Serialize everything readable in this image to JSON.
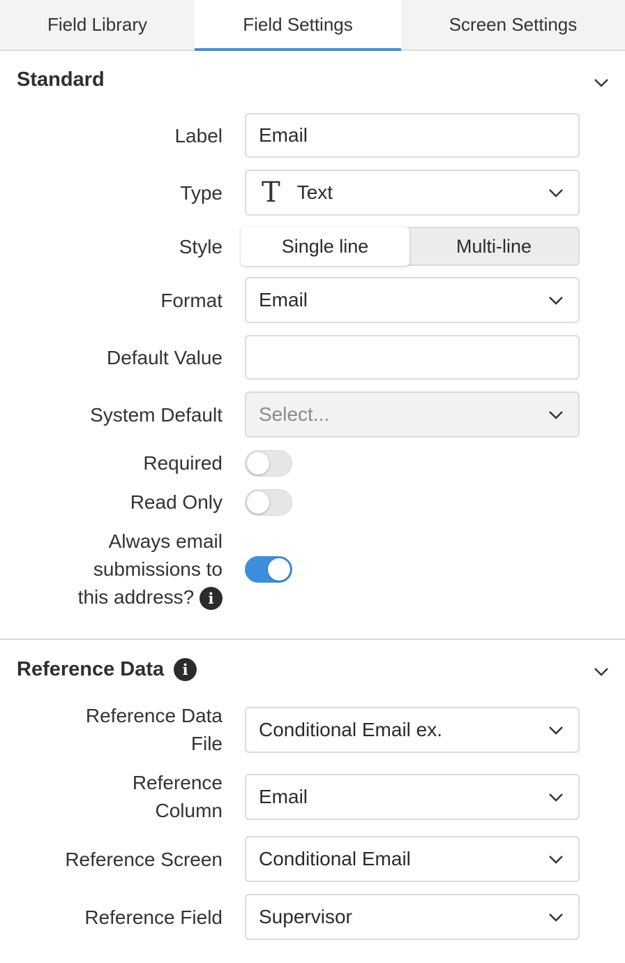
{
  "tabs": [
    {
      "label": "Field Library"
    },
    {
      "label": "Field Settings"
    },
    {
      "label": "Screen Settings"
    }
  ],
  "standard": {
    "title": "Standard",
    "label_label": "Label",
    "label_value": "Email",
    "type_label": "Type",
    "type_icon": "T",
    "type_value": "Text",
    "style_label": "Style",
    "style_options": [
      "Single line",
      "Multi-line"
    ],
    "style_selected": "Single line",
    "format_label": "Format",
    "format_value": "Email",
    "default_label": "Default Value",
    "default_value": "",
    "system_default_label": "System Default",
    "system_default_placeholder": "Select...",
    "required_label": "Required",
    "required_on": false,
    "readonly_label": "Read Only",
    "readonly_on": false,
    "always_email_label_1": "Always email",
    "always_email_label_2": "submissions to",
    "always_email_label_3": "this address?",
    "always_email_on": true
  },
  "reference": {
    "title": "Reference Data",
    "file_label_1": "Reference Data",
    "file_label_2": "File",
    "file_value": "Conditional Email ex.",
    "column_label_1": "Reference",
    "column_label_2": "Column",
    "column_value": "Email",
    "screen_label": "Reference Screen",
    "screen_value": "Conditional Email",
    "field_label": "Reference Field",
    "field_value": "Supervisor"
  },
  "colors": {
    "accent": "#3d8fdb",
    "tab_bg": "#f3f3f3",
    "disabled_bg": "#f2f2f2"
  }
}
